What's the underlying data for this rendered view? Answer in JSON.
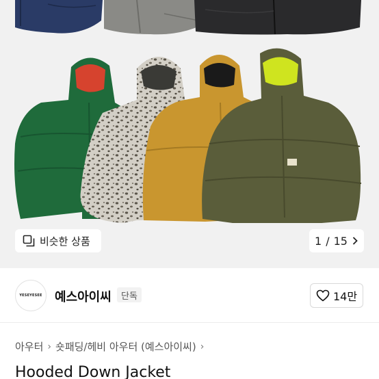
{
  "similar": {
    "label": "비슷한 상품"
  },
  "pager": {
    "current": "1",
    "separator": "/",
    "total": "15"
  },
  "brand": {
    "logo_text": "YESEYESEE",
    "name": "예스아이씨",
    "badge": "단독"
  },
  "like": {
    "count": "14만"
  },
  "breadcrumb": {
    "level1": "아우터",
    "level2": "숏패딩/헤비 아우터 (예스아이씨)"
  },
  "product": {
    "title": "Hooded Down Jacket"
  },
  "colors": {
    "green": "#1f6b3b",
    "leopard": "#cfcac0",
    "mustard": "#c9962f",
    "olive": "#5a5d3a",
    "red_lining": "#d6432e",
    "lime_lining": "#cfe41f",
    "navy": "#2a3b66",
    "grey": "#8a8a86",
    "black": "#2a2a2c"
  }
}
